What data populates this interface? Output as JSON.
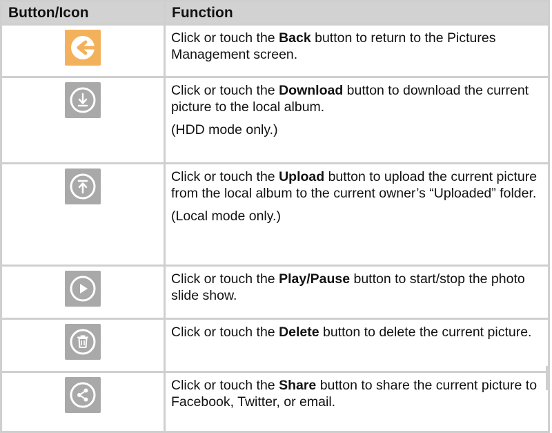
{
  "table": {
    "headers": [
      "Button/Icon",
      "Function"
    ],
    "rows": [
      {
        "icon": "back-arrow-icon",
        "icon_color": "#f3b15c",
        "pre": "Click or touch the ",
        "bold": "Back",
        "post": " button to return to the Pictures Management screen.",
        "note": ""
      },
      {
        "icon": "download-icon",
        "icon_color": "#a9a9a9",
        "pre": "Click or touch the ",
        "bold": "Download",
        "post": " button to download the current picture to the local album.",
        "note": "(HDD mode only.)"
      },
      {
        "icon": "upload-icon",
        "icon_color": "#a9a9a9",
        "pre": "Click or touch the ",
        "bold": "Upload",
        "post": " button to upload the current picture from the local album to the current owner’s “Uploaded” folder.",
        "note": "(Local mode only.)"
      },
      {
        "icon": "play-icon",
        "icon_color": "#a9a9a9",
        "pre": "Click or touch the ",
        "bold": "Play/Pause",
        "post": " button to start/stop the photo slide show.",
        "note": ""
      },
      {
        "icon": "delete-icon",
        "icon_color": "#a9a9a9",
        "pre": "Click or touch the ",
        "bold": "Delete",
        "post": " button to delete the current picture.",
        "note": ""
      },
      {
        "icon": "share-icon",
        "icon_color": "#a9a9a9",
        "pre": "Click or touch the ",
        "bold": "Share",
        "post": " button to share the current picture to Facebook, Twitter, or email.",
        "note": ""
      }
    ]
  }
}
